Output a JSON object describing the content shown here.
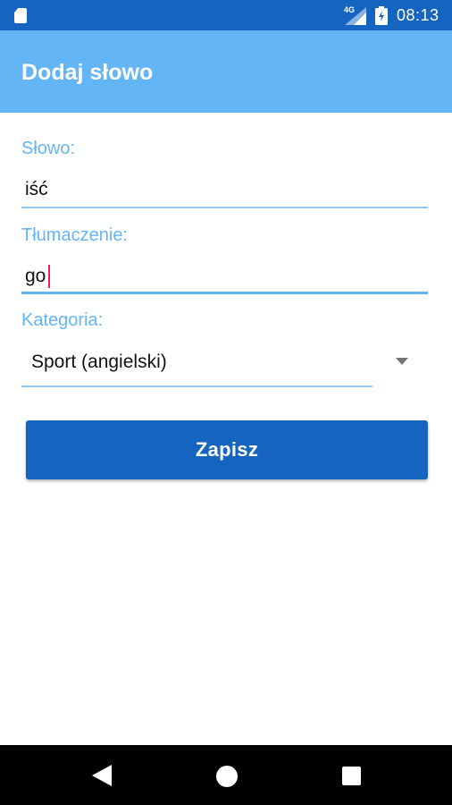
{
  "status_bar": {
    "time": "08:13",
    "network": "4G",
    "icons": [
      "sd-card-icon",
      "signal-icon",
      "battery-charging-icon"
    ]
  },
  "app_bar": {
    "title": "Dodaj słowo"
  },
  "form": {
    "word": {
      "label": "Słowo:",
      "value": "iść"
    },
    "translation": {
      "label": "Tłumaczenie:",
      "value": "go"
    },
    "category": {
      "label": "Kategoria:",
      "selected": "Sport (angielski)"
    },
    "save_label": "Zapisz"
  },
  "colors": {
    "primary_dark": "#1565c0",
    "primary": "#64b5f6",
    "underline": "#90caf9",
    "cursor": "#e91e63"
  },
  "nav_bar": {
    "icons": [
      "back-icon",
      "home-icon",
      "recent-apps-icon"
    ]
  }
}
